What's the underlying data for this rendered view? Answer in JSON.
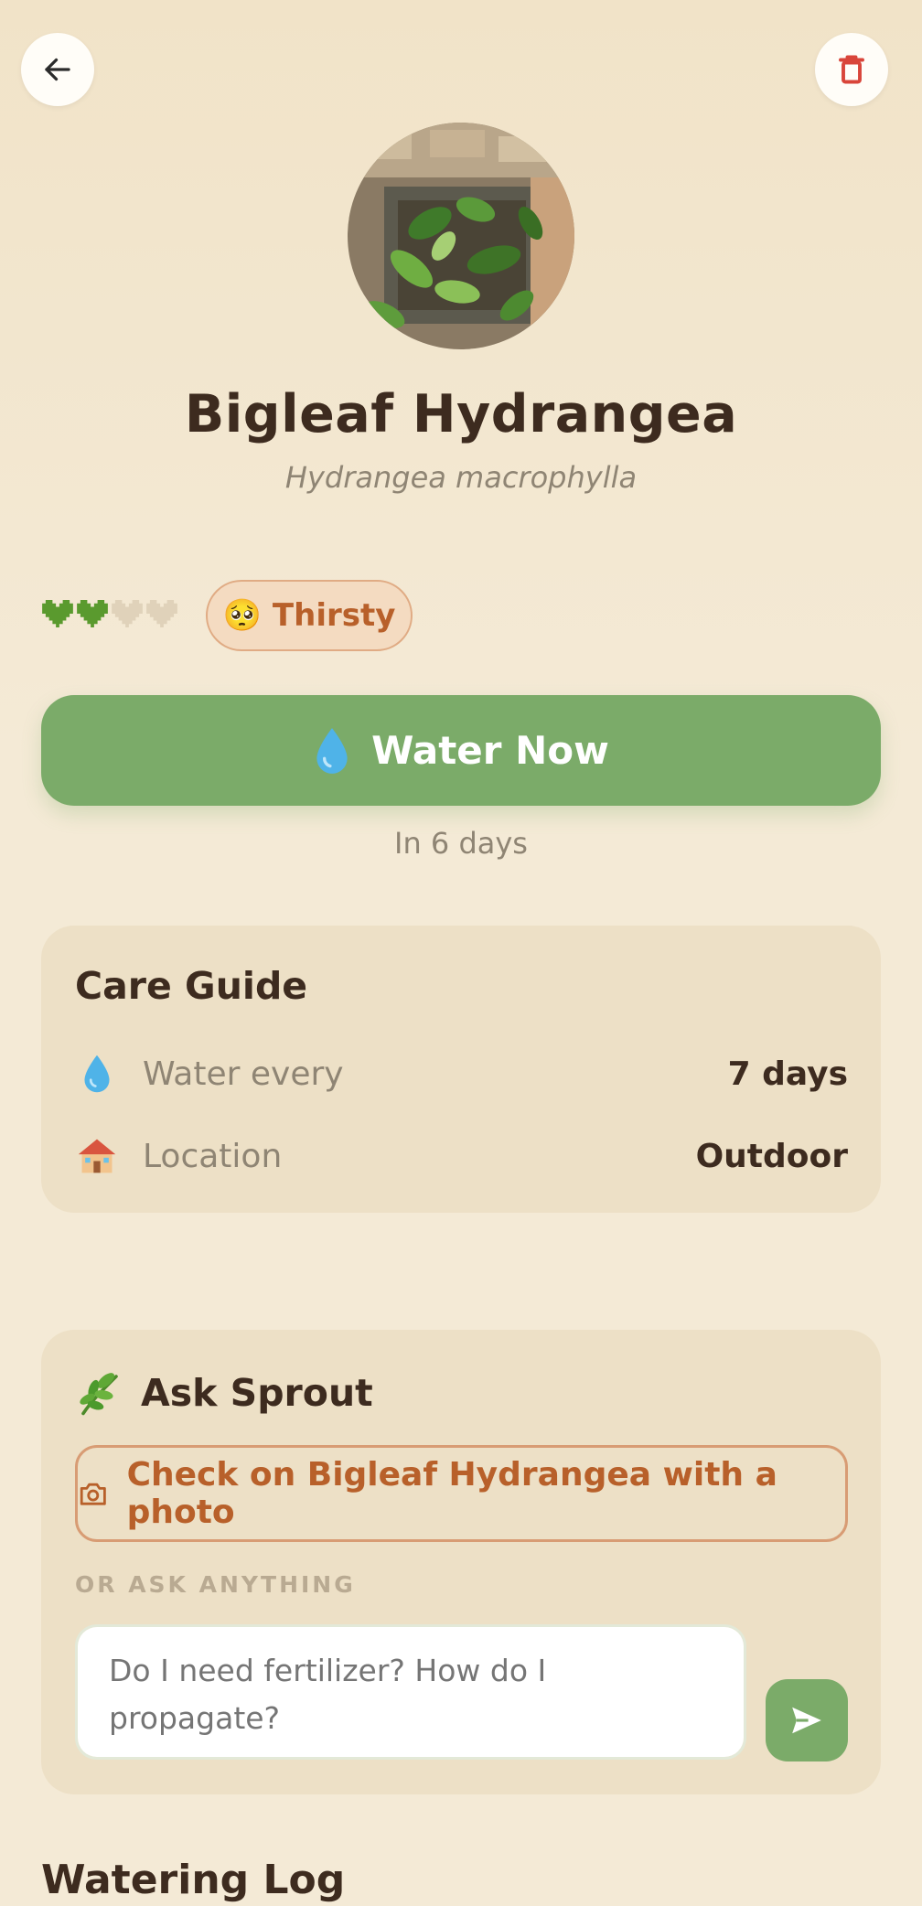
{
  "header": {
    "back_icon": "arrow-left-icon",
    "delete_icon": "trash-icon",
    "accent_delete": "#d9453a"
  },
  "plant": {
    "name": "Bigleaf Hydrangea",
    "scientific_name": "Hydrangea macrophylla",
    "photo": "plant-photo"
  },
  "health": {
    "hearts_total": 4,
    "hearts_filled": 2,
    "filled_color": "#5a9a2e",
    "empty_color": "#e0d2ba",
    "status_emoji": "🥺",
    "status_label": "Thirsty"
  },
  "water": {
    "button_icon": "water-drop-icon",
    "button_label": "Water Now",
    "next_text": "In 6 days",
    "accent": "#7bab69"
  },
  "care_guide": {
    "title": "Care Guide",
    "rows": [
      {
        "icon": "water-drop-icon",
        "label": "Water every",
        "value": "7 days"
      },
      {
        "icon": "house-icon",
        "label": "Location",
        "value": "Outdoor"
      }
    ]
  },
  "ask": {
    "icon": "herb-icon",
    "title": "Ask Sprout",
    "photo_button_icon": "camera-icon",
    "photo_button_label": "Check on Bigleaf Hydrangea with a photo",
    "or_label": "OR ASK ANYTHING",
    "input_placeholder": "Do I need fertilizer? How do I propagate?",
    "send_icon": "send-icon"
  },
  "watering_log": {
    "title": "Watering Log"
  }
}
